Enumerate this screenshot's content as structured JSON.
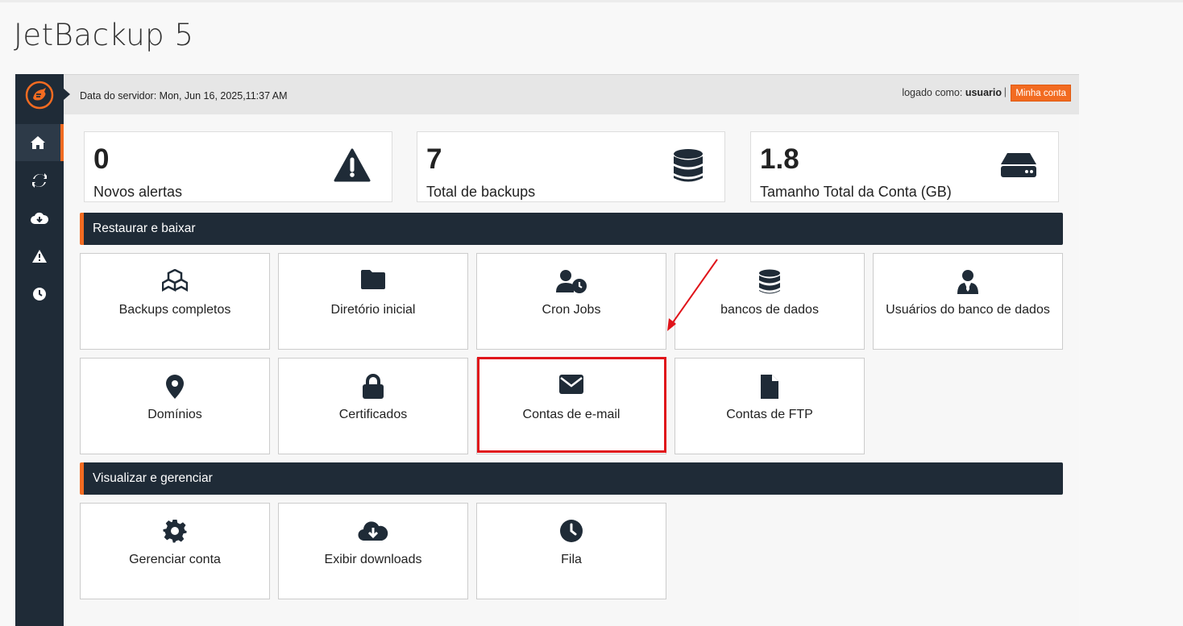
{
  "page_title": "JetBackup 5",
  "topbar": {
    "server_date": "Data do servidor: Mon, Jun 16, 2025,11:37 AM",
    "logged_as_prefix": "logado como: ",
    "username": "usuario",
    "separator": "|",
    "my_account_label": "Minha conta"
  },
  "sidebar": {
    "items": [
      {
        "icon": "home-icon",
        "active": true
      },
      {
        "icon": "refresh-icon",
        "active": false
      },
      {
        "icon": "cloud-download-icon",
        "active": false
      },
      {
        "icon": "warning-icon",
        "active": false
      },
      {
        "icon": "clock-icon",
        "active": false
      }
    ]
  },
  "stats": [
    {
      "value": "0",
      "label": "Novos alertas",
      "icon": "warning-icon"
    },
    {
      "value": "7",
      "label": "Total de backups",
      "icon": "database-icon"
    },
    {
      "value": "1.8",
      "label": "Tamanho Total da Conta (GB)",
      "icon": "hdd-icon"
    }
  ],
  "sections": {
    "restore": {
      "title": "Restaurar e baixar",
      "tiles": [
        {
          "label": "Backups completos",
          "icon": "cubes-icon"
        },
        {
          "label": "Diretório inicial",
          "icon": "folder-icon"
        },
        {
          "label": "Cron Jobs",
          "icon": "user-clock-icon"
        },
        {
          "label": "bancos de dados",
          "icon": "database-icon"
        },
        {
          "label": "Usuários do banco de dados",
          "icon": "user-tie-icon"
        },
        {
          "label": "Domínios",
          "icon": "map-marker-icon"
        },
        {
          "label": "Certificados",
          "icon": "lock-icon"
        },
        {
          "label": "Contas de e-mail",
          "icon": "envelope-icon"
        },
        {
          "label": "Contas de FTP",
          "icon": "file-icon"
        }
      ]
    },
    "manage": {
      "title": "Visualizar e gerenciar",
      "tiles": [
        {
          "label": "Gerenciar conta",
          "icon": "gear-icon"
        },
        {
          "label": "Exibir downloads",
          "icon": "cloud-download-icon"
        },
        {
          "label": "Fila",
          "icon": "clock-icon"
        }
      ]
    }
  },
  "colors": {
    "accent": "#f26b21",
    "sidebar": "#1f2b37",
    "highlight": "#e0141a"
  }
}
